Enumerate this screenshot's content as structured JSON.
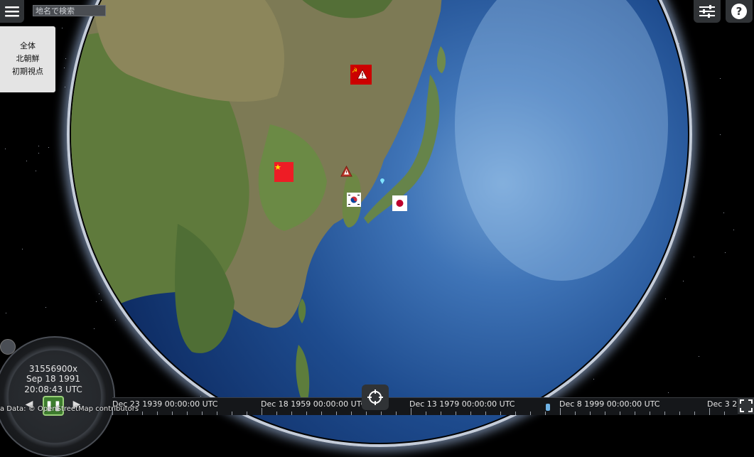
{
  "search": {
    "placeholder": "地名で検索"
  },
  "view_panel": {
    "items": [
      "全体",
      "北朝鮮",
      "初期視点"
    ]
  },
  "animation": {
    "speed": "31556900x",
    "date": "Sep 18 1991",
    "time": "20:08:43 UTC"
  },
  "timeline": {
    "labels": [
      "Dec 23 1939 00:00:00 UTC",
      "Dec 18 1959 00:00:00 UTC",
      "Dec 13 1979 00:00:00 UTC",
      "Dec 8 1999 00:00:00 UTC",
      "Dec 3 2"
    ]
  },
  "credits": "a Data: © OpenStreetMap contributors",
  "markers": [
    {
      "type": "flag",
      "country": "soviet-union",
      "color": "#cc0000"
    },
    {
      "type": "warning",
      "color": "#c0392b"
    },
    {
      "type": "flag",
      "country": "china",
      "color": "#ee1c25"
    },
    {
      "type": "warning",
      "color": "#c0392b"
    },
    {
      "type": "flag",
      "country": "south-korea",
      "color": "#ffffff"
    },
    {
      "type": "flag",
      "country": "japan",
      "color": "#ffffff"
    },
    {
      "type": "point",
      "color": "#7fe3ff"
    }
  ],
  "icons": {
    "menu": "hamburger-icon",
    "settings": "sliders-icon",
    "help": "question-icon",
    "home": "crosshair-icon",
    "fullscreen": "fullscreen-icon"
  }
}
